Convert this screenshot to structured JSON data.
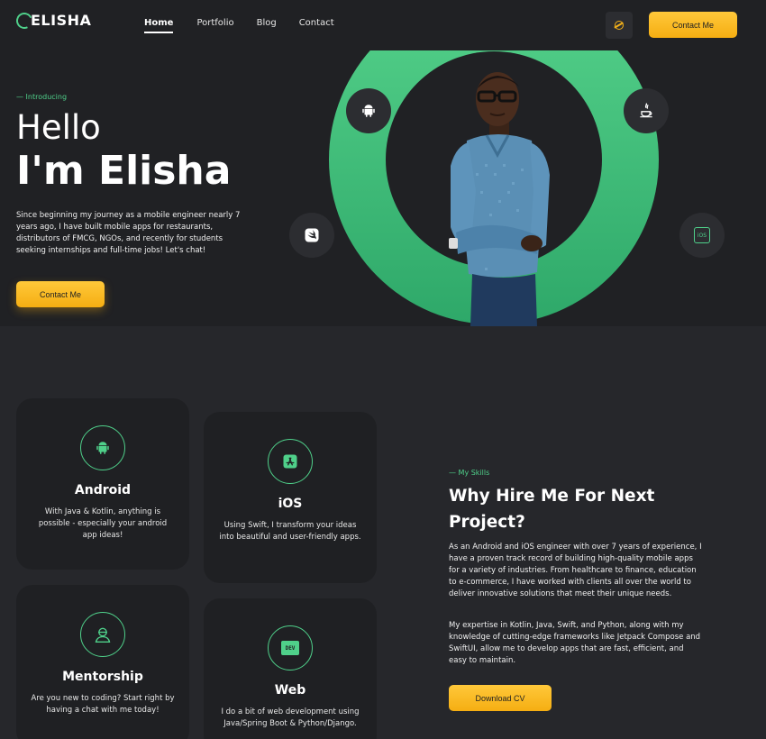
{
  "brand": {
    "name": "ELISHA",
    "accent": "#4fd08a",
    "cta_color": "#f5ae12"
  },
  "nav": {
    "items": [
      {
        "label": "Home",
        "active": true
      },
      {
        "label": "Portfolio",
        "active": false
      },
      {
        "label": "Blog",
        "active": false
      },
      {
        "label": "Contact",
        "active": false
      }
    ]
  },
  "header": {
    "social_icon": "dribbble-icon",
    "cta_label": "Contact Me"
  },
  "hero": {
    "eyebrow": "— Introducing",
    "greeting": "Hello",
    "name": "I'm Elisha",
    "bio": "Since beginning my journey as a mobile engineer nearly 7 years ago, I have built mobile apps for restaurants, distributors of FMCG, NGOs, and recently for students seeking internships and full-time jobs! Let's chat!",
    "cta_label": "Contact Me",
    "floating_icons": [
      "android-icon",
      "java-icon",
      "swift-icon",
      "ios-icon"
    ],
    "ios_badge": "iOS"
  },
  "services": [
    {
      "icon": "android-icon",
      "title": "Android",
      "description": "With Java & Kotlin, anything is possible - especially your android app ideas!"
    },
    {
      "icon": "app-store-icon",
      "title": "iOS",
      "description": "Using Swift, I transform your ideas into beautiful and user-friendly apps."
    },
    {
      "icon": "mentor-icon",
      "title": "Mentorship",
      "description": "Are you new to coding? Start right by having a chat with me today!"
    },
    {
      "icon": "dev-icon",
      "title": "Web",
      "description": "I do a bit of web development using Java/Spring Boot & Python/Django.",
      "badge": "DEV"
    }
  ],
  "skills": {
    "eyebrow": "— My Skills",
    "title": "Why Hire Me For Next Project?",
    "paragraph1": "As an Android and iOS engineer with over 7 years of experience, I have a proven track record of building high-quality mobile apps for a variety of industries. From healthcare to finance, education to e-commerce, I have worked with clients all over the world to deliver innovative solutions that meet their unique needs.",
    "paragraph2": "My expertise in Kotlin, Java, Swift, and Python, along with my knowledge of cutting-edge frameworks like Jetpack Compose and SwiftUI, allow me to develop apps that are fast, efficient, and easy to maintain.",
    "cv_label": "Download CV"
  }
}
